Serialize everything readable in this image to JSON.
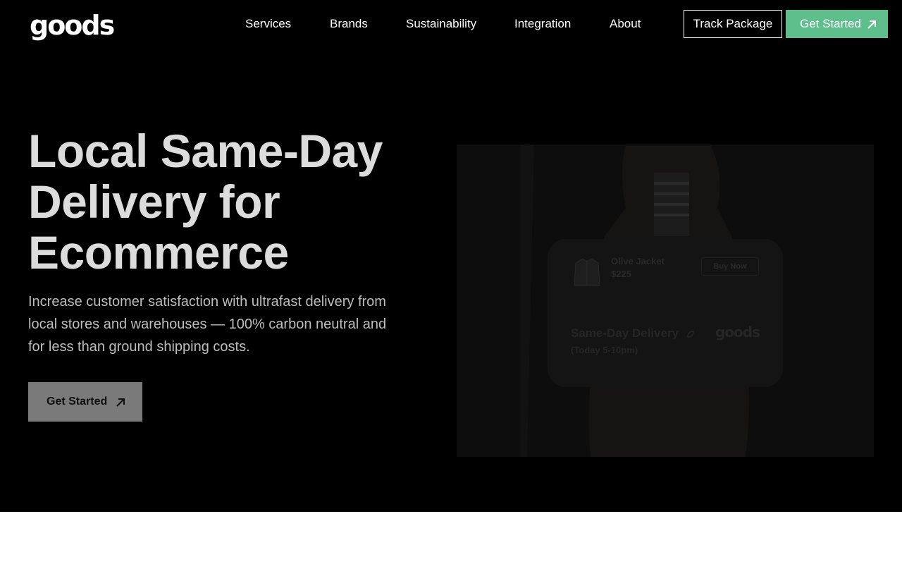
{
  "header": {
    "logo": "goods",
    "nav": [
      "Services",
      "Brands",
      "Sustainability",
      "Integration",
      "About"
    ],
    "track_label": "Track Package",
    "get_started_label": "Get Started"
  },
  "hero": {
    "headline_lines": [
      "Local Same-Day",
      "Delivery for",
      "Ecommerce"
    ],
    "subtext": "Increase customer satisfaction with ultrafast delivery from local stores and warehouses — 100% carbon neutral and for less than ground shipping costs.",
    "cta_label": "Get Started"
  },
  "card": {
    "product_name": "Olive Jacket",
    "product_price": "$225",
    "buy_label": "Buy Now",
    "delivery_title": "Same-Day Delivery",
    "delivery_time": "(Today 5-10pm)",
    "brand": "goods"
  },
  "icons": {
    "arrow": "arrow-up-right-icon",
    "jacket": "jacket-icon",
    "leaf": "leaf-icon"
  },
  "colors": {
    "accent_green": "#5fbf8c",
    "hero_bg": "#000000"
  }
}
